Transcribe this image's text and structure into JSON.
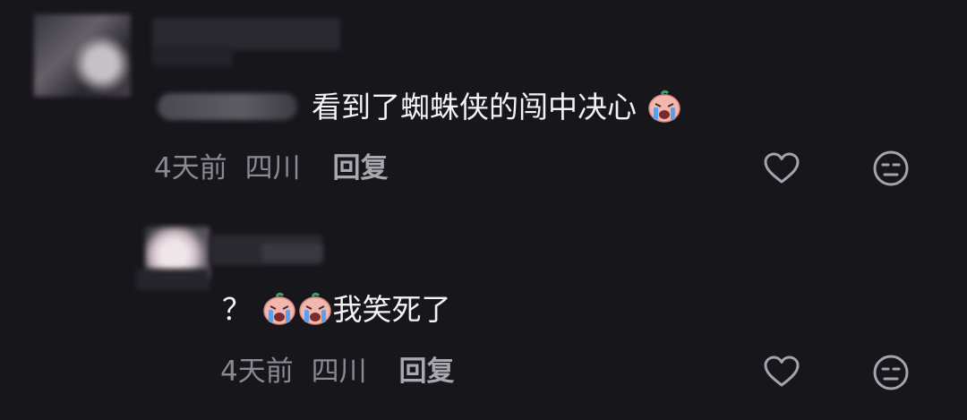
{
  "comment1": {
    "text": "看到了蜘蛛侠的闯中决心",
    "time": "4天前",
    "location": "四川",
    "reply_label": "回复"
  },
  "comment2": {
    "text_prefix": "？",
    "text": "我笑死了",
    "time": "4天前",
    "location": "四川",
    "reply_label": "回复"
  },
  "colors": {
    "background": "#17161b",
    "text": "#f3f3f5",
    "meta": "#8b8a90"
  },
  "icons": [
    "heart-icon",
    "dislike-face-icon",
    "crying-emoji-icon"
  ]
}
